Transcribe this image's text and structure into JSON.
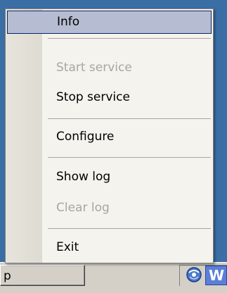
{
  "menu": {
    "items": [
      {
        "label": "Info",
        "state": "highlighted"
      },
      {
        "label": "Start service",
        "state": "disabled"
      },
      {
        "label": "Stop service",
        "state": "enabled"
      },
      {
        "label": "Configure",
        "state": "enabled"
      },
      {
        "label": "Show log",
        "state": "enabled"
      },
      {
        "label": "Clear log",
        "state": "disabled"
      },
      {
        "label": "Exit",
        "state": "enabled"
      }
    ]
  },
  "taskbar": {
    "task_label": "p",
    "tray_app_label": "W",
    "tray_icon": "network-globe-icon"
  },
  "colors": {
    "desktop": "#3a6ea5",
    "menu_background": "#f4f3ee",
    "highlight": "#b6bdd2",
    "highlight_border": "#0a246a",
    "disabled_text": "#a7a69f"
  }
}
